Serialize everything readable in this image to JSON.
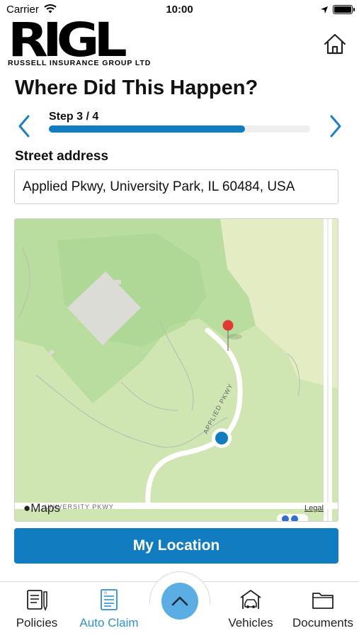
{
  "status_bar": {
    "carrier": "Carrier",
    "time": "10:00"
  },
  "header": {
    "logo_text": "RIGL",
    "logo_subtitle": "RUSSELL INSURANCE GROUP LTD",
    "home_icon": "home-icon"
  },
  "page": {
    "title": "Where Did This Happen?"
  },
  "stepper": {
    "label": "Step 3 / 4",
    "progress_fraction": 0.75,
    "prev_icon": "chevron-left-icon",
    "next_icon": "chevron-right-icon",
    "accent_color": "#127cc0"
  },
  "address": {
    "label": "Street address",
    "value": "Applied Pkwy, University Park, IL 60484, USA"
  },
  "map": {
    "attribution": "Maps",
    "legal": "Legal",
    "road_labels": [
      "APPLIED PKWY",
      "UNIVERSITY PKWY"
    ]
  },
  "actions": {
    "my_location": "My Location"
  },
  "tab_bar": {
    "items": [
      {
        "label": "Policies",
        "icon": "document-pen-icon",
        "active": false
      },
      {
        "label": "Auto Claim",
        "icon": "claim-form-icon",
        "active": true
      },
      {
        "label": "Vehicles",
        "icon": "car-garage-icon",
        "active": false
      },
      {
        "label": "Documents",
        "icon": "folder-icon",
        "active": false
      }
    ],
    "center_icon": "chevron-up-icon",
    "active_color": "#2e8fd1"
  }
}
